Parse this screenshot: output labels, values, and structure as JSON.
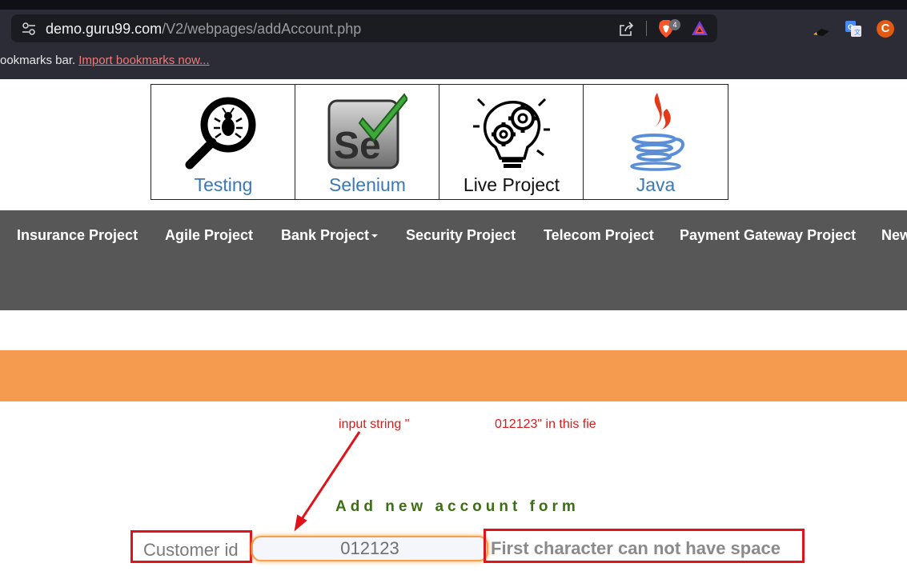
{
  "browser": {
    "url_host": "demo.guru99.com",
    "url_path": "/V2/webpages/addAccount.php",
    "brave_count": "4",
    "bookmarks_text": "ookmarks bar.",
    "bookmarks_link": "Import bookmarks now...",
    "extension_c": "C",
    "icons": [
      "tune-icon",
      "share-icon",
      "brave-shield-icon",
      "brave-rewards-icon",
      "pen-extension-icon",
      "translate-extension-icon"
    ]
  },
  "logos": [
    {
      "label": "Testing",
      "icon": "magnifier-bug-icon"
    },
    {
      "label": "Selenium",
      "icon": "selenium-icon"
    },
    {
      "label": "Live Project",
      "icon": "idea-gears-icon"
    },
    {
      "label": "Java",
      "icon": "java-icon"
    }
  ],
  "nav": [
    {
      "label": "Insurance Project"
    },
    {
      "label": "Agile Project"
    },
    {
      "label": "Bank Project"
    },
    {
      "label": "Security Project"
    },
    {
      "label": "Telecom Project"
    },
    {
      "label": "Payment Gateway Project"
    },
    {
      "label": "New"
    }
  ],
  "annotation": {
    "part1": "input string \"",
    "part2": "012123\" in this fie"
  },
  "form": {
    "title": "Add new account form",
    "customer_label": "Customer id",
    "customer_value": "012123",
    "error": "First character can not have space"
  },
  "colors": {
    "nav_bg": "#575757",
    "orange_band": "#f59b4f",
    "annotation_red": "#e0121a",
    "title_green": "#3c6e12",
    "logo_link_blue": "#3a78b6"
  }
}
